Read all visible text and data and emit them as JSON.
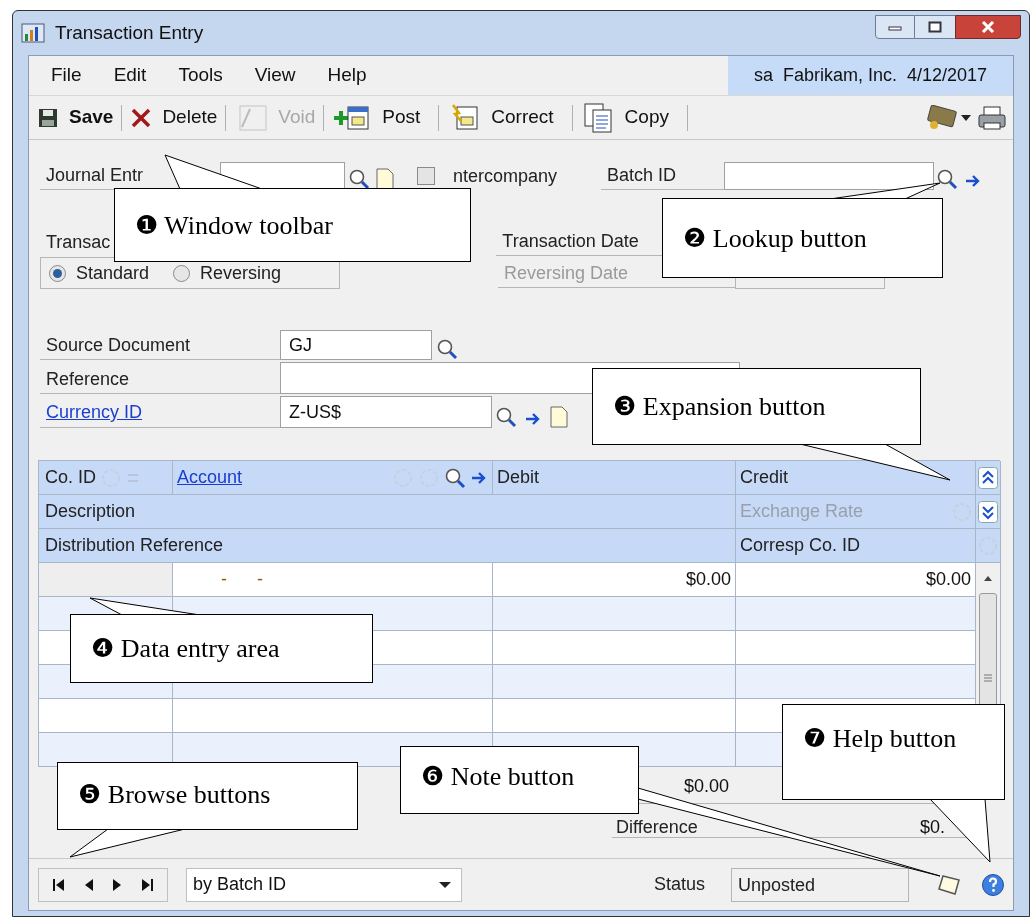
{
  "window": {
    "title": "Transaction Entry"
  },
  "menu": [
    "File",
    "Edit",
    "Tools",
    "View",
    "Help"
  ],
  "user_info": "sa  Fabrikam, Inc.  4/12/2017",
  "toolbar": [
    {
      "kind": "save",
      "label": "Save",
      "disabled": false
    },
    {
      "kind": "delete",
      "label": "Delete",
      "disabled": false
    },
    {
      "kind": "void",
      "label": "Void",
      "disabled": true
    },
    {
      "kind": "post",
      "label": "Post",
      "disabled": false
    },
    {
      "kind": "correct",
      "label": "Correct",
      "disabled": false
    },
    {
      "kind": "copy",
      "label": "Copy",
      "disabled": false
    }
  ],
  "header": {
    "journal_entry": {
      "label": "Journal Entr"
    },
    "intercompany": {
      "label": "ntercompany",
      "checked": false
    },
    "batch_id": {
      "label": "Batch ID"
    },
    "transaction_type": {
      "label": "Transac",
      "options": [
        {
          "label": "Standard",
          "selected": true
        },
        {
          "label": "Reversing",
          "selected": false
        }
      ]
    },
    "transaction_date": {
      "label": "Transaction Date"
    },
    "reversing_date": {
      "label": "Reversing Date",
      "disabled": true
    }
  },
  "fields": {
    "source_document": {
      "label": "Source Document",
      "value": "GJ"
    },
    "reference": {
      "label": "Reference"
    },
    "currency_id": {
      "label": "Currency ID",
      "value": "Z-US$"
    }
  },
  "grid": {
    "headers": {
      "co_id": "Co. ID",
      "account": "Account",
      "debit": "Debit",
      "credit": "Credit",
      "description": "Description",
      "exchange_rate": {
        "label": "Exchange Rate",
        "disabled": true
      },
      "distribution_reference": "Distribution Reference",
      "corresp_co_id": "Corresp Co. ID"
    },
    "rows": [
      {
        "account": "-      -",
        "debit": "$0.00",
        "credit": "$0.00"
      }
    ],
    "totals": {
      "debit": "$0.00",
      "difference_label": "Difference",
      "difference": "$0."
    }
  },
  "footer": {
    "sort": "by Batch ID",
    "status_label": "Status",
    "status": "Unposted"
  },
  "callouts": [
    {
      "text": "❶ Window toolbar"
    },
    {
      "text": "❷ Lookup button"
    },
    {
      "text": "❸ Expansion button"
    },
    {
      "text": "❹ Data entry area"
    },
    {
      "text": "❺ Browse buttons"
    },
    {
      "text": "❻ Note button"
    },
    {
      "text": "❼ Help button"
    }
  ]
}
